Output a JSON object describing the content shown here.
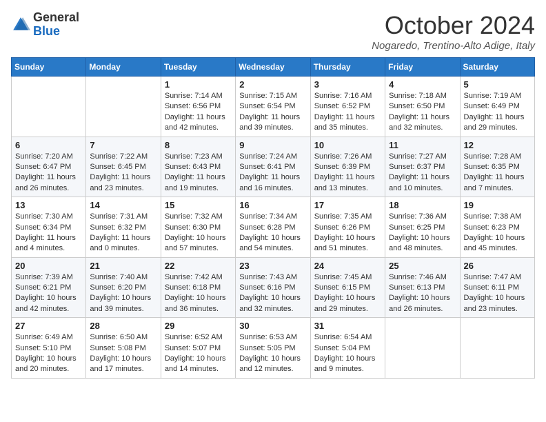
{
  "header": {
    "logo_general": "General",
    "logo_blue": "Blue",
    "month_title": "October 2024",
    "location": "Nogaredo, Trentino-Alto Adige, Italy"
  },
  "days_of_week": [
    "Sunday",
    "Monday",
    "Tuesday",
    "Wednesday",
    "Thursday",
    "Friday",
    "Saturday"
  ],
  "weeks": [
    [
      {
        "day": "",
        "info": ""
      },
      {
        "day": "",
        "info": ""
      },
      {
        "day": "1",
        "info": "Sunrise: 7:14 AM\nSunset: 6:56 PM\nDaylight: 11 hours and 42 minutes."
      },
      {
        "day": "2",
        "info": "Sunrise: 7:15 AM\nSunset: 6:54 PM\nDaylight: 11 hours and 39 minutes."
      },
      {
        "day": "3",
        "info": "Sunrise: 7:16 AM\nSunset: 6:52 PM\nDaylight: 11 hours and 35 minutes."
      },
      {
        "day": "4",
        "info": "Sunrise: 7:18 AM\nSunset: 6:50 PM\nDaylight: 11 hours and 32 minutes."
      },
      {
        "day": "5",
        "info": "Sunrise: 7:19 AM\nSunset: 6:49 PM\nDaylight: 11 hours and 29 minutes."
      }
    ],
    [
      {
        "day": "6",
        "info": "Sunrise: 7:20 AM\nSunset: 6:47 PM\nDaylight: 11 hours and 26 minutes."
      },
      {
        "day": "7",
        "info": "Sunrise: 7:22 AM\nSunset: 6:45 PM\nDaylight: 11 hours and 23 minutes."
      },
      {
        "day": "8",
        "info": "Sunrise: 7:23 AM\nSunset: 6:43 PM\nDaylight: 11 hours and 19 minutes."
      },
      {
        "day": "9",
        "info": "Sunrise: 7:24 AM\nSunset: 6:41 PM\nDaylight: 11 hours and 16 minutes."
      },
      {
        "day": "10",
        "info": "Sunrise: 7:26 AM\nSunset: 6:39 PM\nDaylight: 11 hours and 13 minutes."
      },
      {
        "day": "11",
        "info": "Sunrise: 7:27 AM\nSunset: 6:37 PM\nDaylight: 11 hours and 10 minutes."
      },
      {
        "day": "12",
        "info": "Sunrise: 7:28 AM\nSunset: 6:35 PM\nDaylight: 11 hours and 7 minutes."
      }
    ],
    [
      {
        "day": "13",
        "info": "Sunrise: 7:30 AM\nSunset: 6:34 PM\nDaylight: 11 hours and 4 minutes."
      },
      {
        "day": "14",
        "info": "Sunrise: 7:31 AM\nSunset: 6:32 PM\nDaylight: 11 hours and 0 minutes."
      },
      {
        "day": "15",
        "info": "Sunrise: 7:32 AM\nSunset: 6:30 PM\nDaylight: 10 hours and 57 minutes."
      },
      {
        "day": "16",
        "info": "Sunrise: 7:34 AM\nSunset: 6:28 PM\nDaylight: 10 hours and 54 minutes."
      },
      {
        "day": "17",
        "info": "Sunrise: 7:35 AM\nSunset: 6:26 PM\nDaylight: 10 hours and 51 minutes."
      },
      {
        "day": "18",
        "info": "Sunrise: 7:36 AM\nSunset: 6:25 PM\nDaylight: 10 hours and 48 minutes."
      },
      {
        "day": "19",
        "info": "Sunrise: 7:38 AM\nSunset: 6:23 PM\nDaylight: 10 hours and 45 minutes."
      }
    ],
    [
      {
        "day": "20",
        "info": "Sunrise: 7:39 AM\nSunset: 6:21 PM\nDaylight: 10 hours and 42 minutes."
      },
      {
        "day": "21",
        "info": "Sunrise: 7:40 AM\nSunset: 6:20 PM\nDaylight: 10 hours and 39 minutes."
      },
      {
        "day": "22",
        "info": "Sunrise: 7:42 AM\nSunset: 6:18 PM\nDaylight: 10 hours and 36 minutes."
      },
      {
        "day": "23",
        "info": "Sunrise: 7:43 AM\nSunset: 6:16 PM\nDaylight: 10 hours and 32 minutes."
      },
      {
        "day": "24",
        "info": "Sunrise: 7:45 AM\nSunset: 6:15 PM\nDaylight: 10 hours and 29 minutes."
      },
      {
        "day": "25",
        "info": "Sunrise: 7:46 AM\nSunset: 6:13 PM\nDaylight: 10 hours and 26 minutes."
      },
      {
        "day": "26",
        "info": "Sunrise: 7:47 AM\nSunset: 6:11 PM\nDaylight: 10 hours and 23 minutes."
      }
    ],
    [
      {
        "day": "27",
        "info": "Sunrise: 6:49 AM\nSunset: 5:10 PM\nDaylight: 10 hours and 20 minutes."
      },
      {
        "day": "28",
        "info": "Sunrise: 6:50 AM\nSunset: 5:08 PM\nDaylight: 10 hours and 17 minutes."
      },
      {
        "day": "29",
        "info": "Sunrise: 6:52 AM\nSunset: 5:07 PM\nDaylight: 10 hours and 14 minutes."
      },
      {
        "day": "30",
        "info": "Sunrise: 6:53 AM\nSunset: 5:05 PM\nDaylight: 10 hours and 12 minutes."
      },
      {
        "day": "31",
        "info": "Sunrise: 6:54 AM\nSunset: 5:04 PM\nDaylight: 10 hours and 9 minutes."
      },
      {
        "day": "",
        "info": ""
      },
      {
        "day": "",
        "info": ""
      }
    ]
  ]
}
